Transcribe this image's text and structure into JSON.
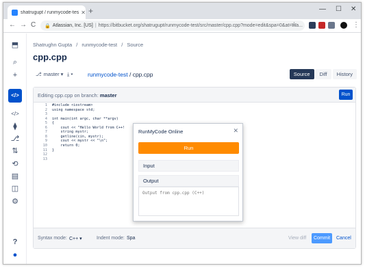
{
  "browser": {
    "tab_title": "shatrugupt / runmycode-test / so...",
    "tab_close": "✕",
    "new_tab": "+",
    "back": "←",
    "forward": "→",
    "reload": "C",
    "lock": "🔒",
    "site_owner": "Atlassian, Inc. [US]",
    "url": "https://bitbucket.org/shatrugupt/runmycode-test/src/master/cpp.cpp?mode=edit&spa=0&at=ma...",
    "star": "☆",
    "menu": "⋮",
    "win_min": "—",
    "win_max": "☐",
    "win_close": "✕"
  },
  "sidebar": {
    "logo": "⬒",
    "search": "⌕",
    "create": "+",
    "active_code": "</>",
    "items": [
      "</>",
      "⧫",
      "⎇",
      "⇅",
      "⟲",
      "▤",
      "◫",
      "⚙"
    ],
    "help": "?",
    "avatar": "●"
  },
  "breadcrumb": [
    "Shatrughn Gupta",
    "/",
    "runmycode-test",
    "/",
    "Source"
  ],
  "page_title": "cpp.cpp",
  "toolbar": {
    "branch": "master ▾",
    "download": "⤓ ▾",
    "repo_link": "runmycode-test",
    "path_sep": " / ",
    "file": "cpp.cpp",
    "views": [
      "Source",
      "Diff",
      "History"
    ]
  },
  "editor": {
    "heading_prefix": "Editing cpp.cpp on branch: ",
    "branch": "master",
    "run_label": "Run",
    "lines": [
      {
        "n": "1",
        "t": "#include <iostream>"
      },
      {
        "n": "2",
        "t": "using namespace std;"
      },
      {
        "n": "3",
        "t": ""
      },
      {
        "n": "4",
        "t": "int main(int argc, char **argv)"
      },
      {
        "n": "5",
        "t": "{"
      },
      {
        "n": "6",
        "t": "    cout << \"Hello World from C++!"
      },
      {
        "n": "7",
        "t": "    string mystr;"
      },
      {
        "n": "8",
        "t": "    getline(cin, mystr);"
      },
      {
        "n": "9",
        "t": "    cout << mystr << \"\\n\";"
      },
      {
        "n": "10",
        "t": "    return 0;"
      },
      {
        "n": "11",
        "t": "}"
      },
      {
        "n": "12",
        "t": ""
      },
      {
        "n": "13",
        "t": ""
      }
    ],
    "syntax_label": "Syntax mode:",
    "syntax_value": "C++  ▾",
    "indent_label": "Indent mode:",
    "indent_value": "Spa",
    "view_diff": "View diff",
    "commit": "Commit",
    "cancel": "Cancel"
  },
  "popup": {
    "title": "RunMyCode Online",
    "close": "✕",
    "run": "Run",
    "input_label": "Input",
    "output_label": "Output",
    "output_placeholder": "Output from cpp.cpp (C++)"
  },
  "colors": {
    "accent": "#0052cc",
    "run_orange": "#ff8b00"
  }
}
